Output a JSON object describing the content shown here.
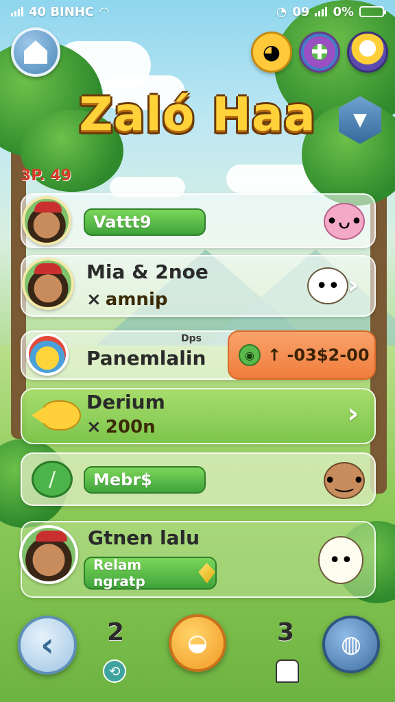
{
  "status_bar": {
    "left_text": "40 BINHC",
    "clock_text": "09",
    "battery_text": "0%"
  },
  "header": {
    "title": "Zaló Haa",
    "score": "3P. 49"
  },
  "rows": [
    {
      "button_label": "Vattt9"
    },
    {
      "name": "Mia & 2noe",
      "sub_value": "amnip"
    },
    {
      "name": "Panemlalin",
      "tag": "Dps",
      "price": "↑ -03$2-00"
    },
    {
      "name": "Derium",
      "sub_value": "200n"
    },
    {
      "button_label": "Mebr$"
    },
    {
      "name": "Gtnen lalu",
      "button_label": "Relam ngratp"
    }
  ],
  "bottom_bar": {
    "count_left": "2",
    "count_right": "3"
  },
  "colors": {
    "accent_green": "#3ea43a",
    "accent_orange": "#ef7d3c",
    "title_yellow": "#ffd23a",
    "score_red": "#d63b2a"
  },
  "icons": [
    "home-icon",
    "dog-icon",
    "puzzle-icon",
    "face-icon",
    "hex-cat-icon",
    "pet-icon",
    "chevron-right-icon",
    "coin-icon",
    "fish-icon",
    "gem-icon",
    "back-icon",
    "whistle-icon",
    "ghost-icon"
  ]
}
